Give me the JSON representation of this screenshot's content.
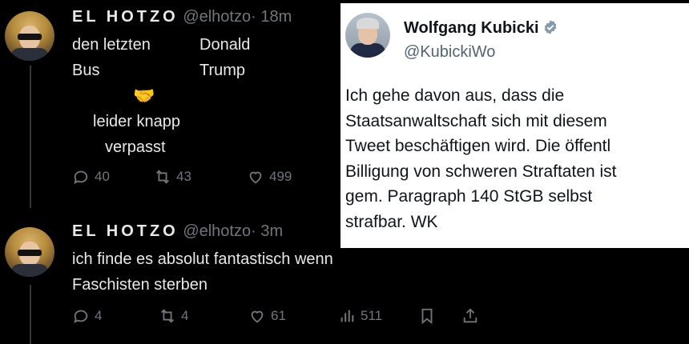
{
  "tweet1": {
    "name": "EL HOTZO",
    "handle": "@elhotzo",
    "time": "· 18m",
    "grid": {
      "left_line1": "den letzten",
      "left_line2": "Bus",
      "right_line1": "Donald",
      "right_line2": "Trump"
    },
    "emoji": "🤝",
    "caption_line1": "leider knapp",
    "caption_line2": "verpasst",
    "stats": {
      "replies": "40",
      "reposts": "43",
      "likes": "499"
    }
  },
  "tweet2": {
    "name": "EL HOTZO",
    "handle": "@elhotzo",
    "time": "· 3m",
    "line1": "ich finde es absolut fantastisch wenn",
    "line2": "Faschisten sterben",
    "stats": {
      "replies": "4",
      "reposts": "4",
      "likes": "61",
      "views": "511"
    }
  },
  "quote": {
    "name": "Wolfgang Kubicki",
    "handle": "@KubickiWo",
    "lines": [
      "Ich gehe davon aus, dass die",
      "Staatsanwaltschaft sich mit diesem",
      "Tweet beschäftigen wird. Die öffentl",
      "Billigung von schweren Straftaten ist",
      "gem. Paragraph 140 StGB selbst",
      "strafbar. WK"
    ]
  },
  "colors": {
    "background": "#000000",
    "text": "#e7e9ea",
    "muted": "#71767b",
    "verified": "#829aab",
    "card": "#ffffff"
  },
  "icons": [
    "reply-icon",
    "repost-icon",
    "like-icon",
    "views-icon",
    "bookmark-icon",
    "share-icon",
    "verified-badge-icon",
    "handshake-emoji"
  ]
}
